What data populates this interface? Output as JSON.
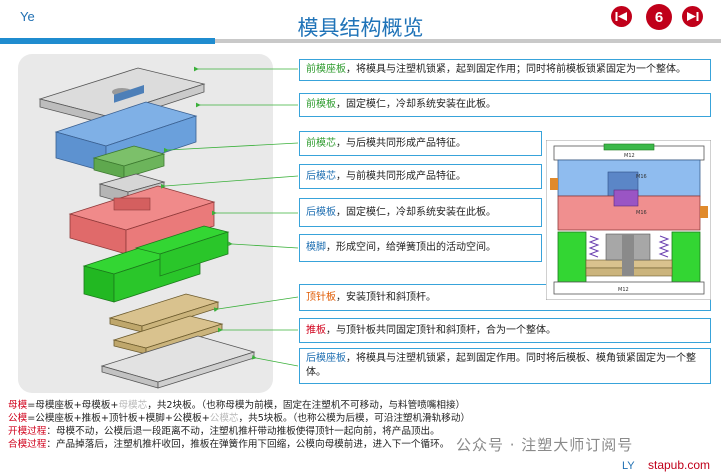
{
  "header": {
    "brand": "Ye",
    "title": "模具结构概览",
    "page_number": "6",
    "prev_icon": "skip-back-icon",
    "next_icon": "skip-forward-icon"
  },
  "descriptions": [
    {
      "keyword": "前模座板",
      "text": "，将模具与注塑机锁紧，起到固定作用；同时将前模板锁紧固定为一个整体。",
      "color": "#2e9b2e"
    },
    {
      "keyword": "前模板",
      "text": "，固定模仁，冷却系统安装在此板。",
      "color": "#2e9b2e"
    },
    {
      "keyword": "前模芯",
      "text": "，与后模共同形成产品特征。",
      "color": "#2e9b2e"
    },
    {
      "keyword": "后模芯",
      "text": "，与前模共同形成产品特征。",
      "color": "#1f6fb2"
    },
    {
      "keyword": "后模板",
      "text": "，固定模仁，冷却系统安装在此板。",
      "color": "#1f6fb2"
    },
    {
      "keyword": "模脚",
      "text": "，形成空间，给弹簧顶出的活动空间。",
      "color": "#1f6fb2"
    },
    {
      "keyword": "顶针板",
      "text": "，安装顶针和斜顶杆。",
      "color": "#e05a00"
    },
    {
      "keyword": "推板",
      "text": "，与顶针板共同固定顶针和斜顶杆，合为一个整体。",
      "color": "#d0001b"
    },
    {
      "keyword": "后模座板",
      "text": "，将模具与注塑机锁紧，起到固定作用。同时将后模板、模角锁紧固定为一个整体。",
      "color": "#1f6fb2"
    }
  ],
  "cross_section": {
    "labels": [
      "M12",
      "M16",
      "M16",
      "M12"
    ]
  },
  "notes": {
    "line1": {
      "k1": "母模",
      "a": "=母模座板+母模板+",
      "g": "母模芯",
      "b": "，共2块板。（也称母模为前模，固定在注塑机不可移动，与料管喷嘴相接）"
    },
    "line2": {
      "k1": "公模",
      "a": "=公模座板+推板+顶针板+模脚+公模板+",
      "g": "公模芯",
      "b": "，共5块板。（也称公模为后模，可沿注塑机滑轨移动）"
    },
    "line3": {
      "k1": "开模过程",
      "a": "：母模不动，公模后退一段距离不动，注塑机推杆带动推板使得顶针一起向前，将产品顶出。"
    },
    "line4": {
      "k1": "合模过程",
      "a": "：产品掉落后，注塑机推杆收回，推板在弹簧作用下回缩，公模向母模前进，进入下一个循环。"
    }
  },
  "watermark": "公众号 · 注塑大师订阅号",
  "footer": {
    "ly": "LY",
    "site": "stapub.com"
  }
}
